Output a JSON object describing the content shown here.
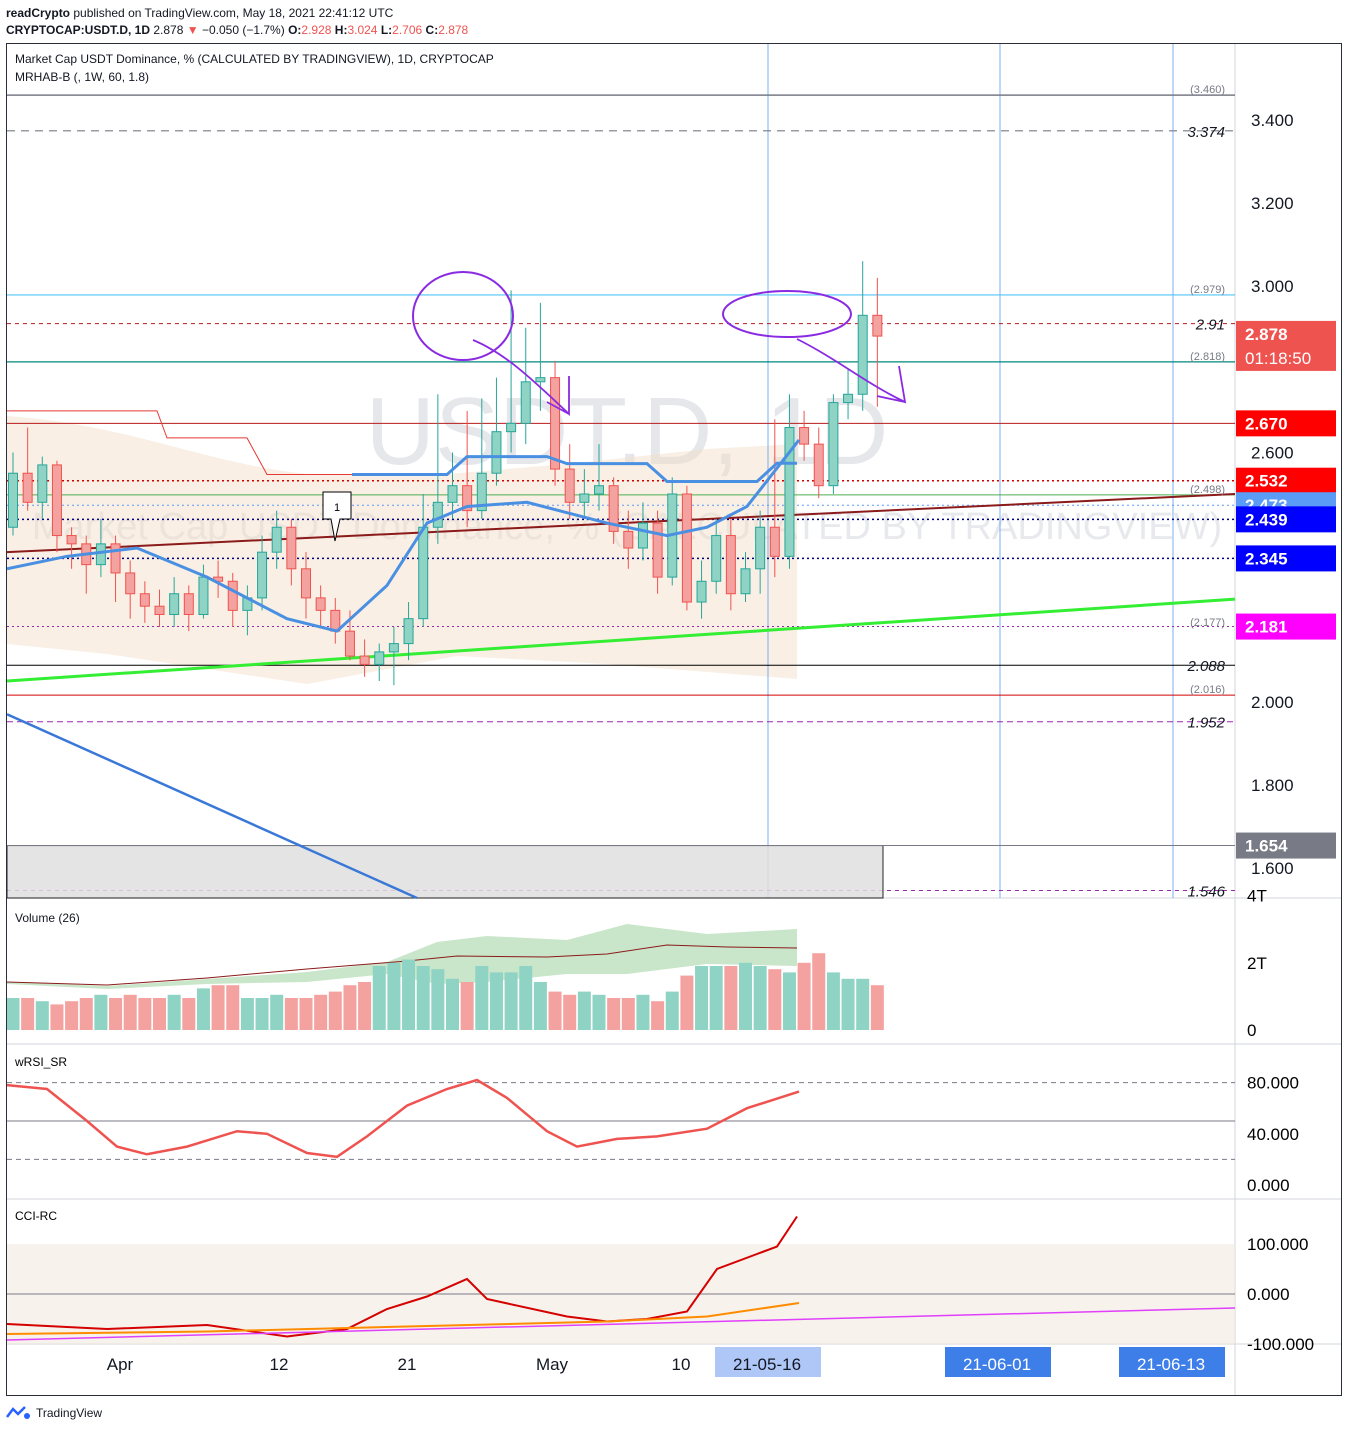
{
  "header": {
    "publisher": "readCrypto",
    "published_line": "published on TradingView.com, May 18, 2021 22:41:12 UTC",
    "symbol": "CRYPTOCAP:USDT.D, 1D",
    "last": "2.878",
    "change": "−0.050 (−1.7%)",
    "ohlc_o": "2.928",
    "ohlc_h": "3.024",
    "ohlc_l": "2.706",
    "ohlc_c": "2.878"
  },
  "chart": {
    "title": "Market Cap USDT Dominance, % (CALCULATED BY TRADINGVIEW), 1D, CRYPTOCAP",
    "indicator": "MRHAB-B (, 1W, 60, 1.8)",
    "watermark_big": "USDT.D, 1D",
    "watermark_small": "Market Cap USDT Dominance, % (CALCULATED BY TRADINGVIEW)",
    "colors": {
      "up": "#26a69a",
      "down": "#ef5350",
      "purple_marker": "#8a2be2"
    }
  },
  "chart_data": {
    "type": "candlestick",
    "price_axis": {
      "ticks": [
        "3.400",
        "3.200",
        "3.000",
        "2.600",
        "2.000",
        "1.800",
        "1.600"
      ],
      "ylim": [
        1.53,
        3.52
      ]
    },
    "price_labels": [
      {
        "text": "2.878",
        "sub": "01:18:50",
        "value": 2.878,
        "color": "#ef5350"
      },
      {
        "text": "2.670",
        "value": 2.67,
        "color": "#ff0000"
      },
      {
        "text": "2.532",
        "value": 2.532,
        "color": "#ff0000"
      },
      {
        "text": "2.473",
        "value": 2.473,
        "color": "#5b9cf6"
      },
      {
        "text": "2.439",
        "value": 2.439,
        "color": "#0000ff"
      },
      {
        "text": "2.345",
        "value": 2.345,
        "color": "#0000ff"
      },
      {
        "text": "2.181",
        "value": 2.181,
        "color": "#ff00ff"
      },
      {
        "text": "1.654",
        "value": 1.654,
        "color": "#787b86"
      }
    ],
    "level_texts": [
      {
        "text": "(3.460)",
        "value": 3.46
      },
      {
        "text": "3.374",
        "value": 3.374
      },
      {
        "text": "(2.979)",
        "value": 2.979
      },
      {
        "text": "2.91",
        "value": 2.91
      },
      {
        "text": "(2.818)",
        "value": 2.818
      },
      {
        "text": "(2.498)",
        "value": 2.498
      },
      {
        "text": "(2.177)",
        "value": 2.177
      },
      {
        "text": "2.088",
        "value": 2.088
      },
      {
        "text": "(2.016)",
        "value": 2.016
      },
      {
        "text": "1.952",
        "value": 1.952
      },
      {
        "text": "1.546",
        "value": 1.546
      }
    ],
    "time_axis": [
      "Apr",
      "12",
      "21",
      "May",
      "10",
      "21-05-16",
      "21-06-01",
      "21-06-13"
    ],
    "candles": [
      [
        2.42,
        2.55,
        2.4,
        2.6
      ],
      [
        2.55,
        2.48,
        2.46,
        2.66
      ],
      [
        2.48,
        2.57,
        2.44,
        2.59
      ],
      [
        2.57,
        2.4,
        2.36,
        2.58
      ],
      [
        2.4,
        2.38,
        2.32,
        2.42
      ],
      [
        2.38,
        2.33,
        2.26,
        2.4
      ],
      [
        2.33,
        2.38,
        2.3,
        2.44
      ],
      [
        2.38,
        2.31,
        2.24,
        2.4
      ],
      [
        2.31,
        2.26,
        2.2,
        2.34
      ],
      [
        2.26,
        2.23,
        2.19,
        2.29
      ],
      [
        2.23,
        2.21,
        2.18,
        2.27
      ],
      [
        2.21,
        2.26,
        2.18,
        2.3
      ],
      [
        2.26,
        2.21,
        2.17,
        2.28
      ],
      [
        2.21,
        2.3,
        2.2,
        2.33
      ],
      [
        2.3,
        2.29,
        2.25,
        2.34
      ],
      [
        2.29,
        2.22,
        2.18,
        2.31
      ],
      [
        2.22,
        2.25,
        2.16,
        2.28
      ],
      [
        2.25,
        2.36,
        2.22,
        2.4
      ],
      [
        2.36,
        2.42,
        2.32,
        2.46
      ],
      [
        2.42,
        2.32,
        2.28,
        2.44
      ],
      [
        2.32,
        2.25,
        2.2,
        2.36
      ],
      [
        2.25,
        2.22,
        2.18,
        2.28
      ],
      [
        2.22,
        2.17,
        2.14,
        2.25
      ],
      [
        2.17,
        2.11,
        2.1,
        2.22
      ],
      [
        2.11,
        2.09,
        2.06,
        2.15
      ],
      [
        2.09,
        2.12,
        2.05,
        2.14
      ],
      [
        2.12,
        2.14,
        2.04,
        2.18
      ],
      [
        2.14,
        2.2,
        2.1,
        2.24
      ],
      [
        2.2,
        2.42,
        2.18,
        2.5
      ],
      [
        2.42,
        2.48,
        2.38,
        2.74
      ],
      [
        2.48,
        2.52,
        2.44,
        2.6
      ],
      [
        2.52,
        2.46,
        2.42,
        2.7
      ],
      [
        2.46,
        2.55,
        2.44,
        2.73
      ],
      [
        2.55,
        2.65,
        2.52,
        2.78
      ],
      [
        2.65,
        2.67,
        2.6,
        2.99
      ],
      [
        2.67,
        2.77,
        2.62,
        2.9
      ],
      [
        2.77,
        2.78,
        2.7,
        2.96
      ],
      [
        2.78,
        2.56,
        2.52,
        2.82
      ],
      [
        2.56,
        2.48,
        2.44,
        2.62
      ],
      [
        2.48,
        2.5,
        2.44,
        2.56
      ],
      [
        2.5,
        2.52,
        2.46,
        2.62
      ],
      [
        2.52,
        2.41,
        2.38,
        2.54
      ],
      [
        2.41,
        2.37,
        2.32,
        2.46
      ],
      [
        2.37,
        2.43,
        2.34,
        2.48
      ],
      [
        2.43,
        2.3,
        2.26,
        2.46
      ],
      [
        2.3,
        2.5,
        2.28,
        2.54
      ],
      [
        2.5,
        2.24,
        2.22,
        2.52
      ],
      [
        2.24,
        2.29,
        2.2,
        2.34
      ],
      [
        2.29,
        2.4,
        2.26,
        2.44
      ],
      [
        2.4,
        2.26,
        2.22,
        2.44
      ],
      [
        2.26,
        2.32,
        2.24,
        2.36
      ],
      [
        2.32,
        2.42,
        2.26,
        2.46
      ],
      [
        2.42,
        2.35,
        2.3,
        2.68
      ],
      [
        2.35,
        2.66,
        2.32,
        2.74
      ],
      [
        2.66,
        2.62,
        2.58,
        2.7
      ],
      [
        2.62,
        2.52,
        2.49,
        2.66
      ],
      [
        2.52,
        2.72,
        2.5,
        2.74
      ],
      [
        2.72,
        2.74,
        2.68,
        2.8
      ],
      [
        2.74,
        2.93,
        2.7,
        3.06
      ],
      [
        2.93,
        2.88,
        2.71,
        3.02
      ]
    ],
    "panes": [
      {
        "name": "Volume (26)",
        "ticks": [
          "4T",
          "2T",
          "0"
        ],
        "volumes": [
          1.0,
          1.0,
          0.9,
          0.8,
          0.9,
          1.0,
          1.1,
          1.0,
          1.1,
          1.0,
          1.0,
          1.1,
          1.0,
          1.3,
          1.4,
          1.4,
          1.0,
          1.0,
          1.1,
          1.0,
          1.0,
          1.1,
          1.2,
          1.4,
          1.5,
          2.0,
          2.1,
          2.2,
          2.0,
          1.9,
          1.6,
          1.5,
          2.0,
          1.8,
          1.8,
          2.0,
          1.5,
          1.2,
          1.1,
          1.2,
          1.1,
          1.0,
          1.0,
          1.1,
          0.9,
          1.2,
          1.7,
          2.0,
          2.0,
          2.0,
          2.1,
          2.0,
          1.9,
          1.8,
          2.1,
          2.4,
          1.8,
          1.6,
          1.6,
          1.4
        ]
      },
      {
        "name": "wRSI_SR",
        "ticks": [
          "80.000",
          "40.000",
          "0.000"
        ]
      },
      {
        "name": "CCI-RC",
        "ticks": [
          "100.000",
          "0.000",
          "-100.000"
        ]
      }
    ]
  }
}
